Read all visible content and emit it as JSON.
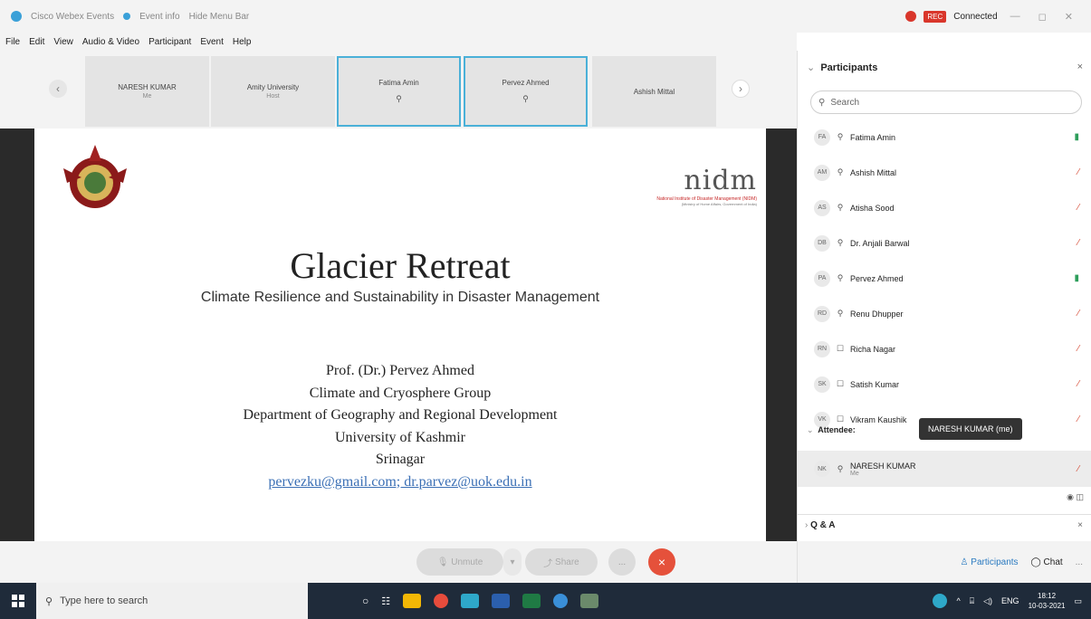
{
  "window": {
    "tabs": [
      "Cisco Webex Events",
      "Event info",
      "Hide Menu Bar"
    ],
    "status": "Connected",
    "rec_badge": "REC"
  },
  "menu": [
    "File",
    "Edit",
    "View",
    "Audio & Video",
    "Participant",
    "Event",
    "Help"
  ],
  "video_strip": {
    "tiles": [
      {
        "name": "NARESH KUMAR",
        "sub": "Me"
      },
      {
        "name": "Amity University",
        "sub": "Host"
      },
      {
        "name": "Fatima Amin",
        "sub": ""
      },
      {
        "name": "Pervez Ahmed",
        "sub": ""
      },
      {
        "name": "Ashish Mittal",
        "sub": ""
      }
    ]
  },
  "slide": {
    "nidm_text": "nidm",
    "nidm_name": "National Institute of Disaster Management (NIDM)",
    "nidm_ministry": "(Ministry of Home Affairs, Government of India)",
    "title": "Glacier Retreat",
    "subtitle": "Climate Resilience and Sustainability in Disaster Management",
    "presenter": "Prof. (Dr.) Pervez Ahmed",
    "group": "Climate and Cryosphere Group",
    "department": "Department of Geography and Regional Development",
    "university": "University of Kashmir",
    "city": "Srinagar",
    "emails": "pervezku@gmail.com; dr.parvez@uok.edu.in"
  },
  "controls": {
    "unmute": "Unmute",
    "share": "Share",
    "more": "...",
    "leave": "×"
  },
  "panel": {
    "title": "Participants",
    "search_placeholder": "Search",
    "participants": [
      {
        "initials": "FA",
        "name": "Fatima Amin",
        "state": "on"
      },
      {
        "initials": "AM",
        "name": "Ashish Mittal",
        "state": "off"
      },
      {
        "initials": "AS",
        "name": "Atisha Sood",
        "state": "off"
      },
      {
        "initials": "DB",
        "name": "Dr. Anjali Barwal",
        "state": "off"
      },
      {
        "initials": "PA",
        "name": "Pervez Ahmed",
        "state": "on"
      },
      {
        "initials": "RD",
        "name": "Renu Dhupper",
        "state": "off"
      },
      {
        "initials": "RN",
        "name": "Richa Nagar",
        "state": "off"
      },
      {
        "initials": "SK",
        "name": "Satish Kumar",
        "state": "off"
      },
      {
        "initials": "VK",
        "name": "Vikram Kaushik",
        "state": "off"
      }
    ],
    "attendee_label": "Attendee:",
    "me": {
      "initials": "NK",
      "name": "NARESH KUMAR",
      "sub": "Me"
    },
    "tooltip": "NARESH KUMAR (me)",
    "qa_label": "Q & A",
    "footer_participants": "Participants",
    "footer_chat": "Chat",
    "footer_more": "..."
  },
  "taskbar": {
    "search_placeholder": "Type here to search",
    "lang": "ENG",
    "time": "18:12",
    "date": "10-03-2021"
  }
}
